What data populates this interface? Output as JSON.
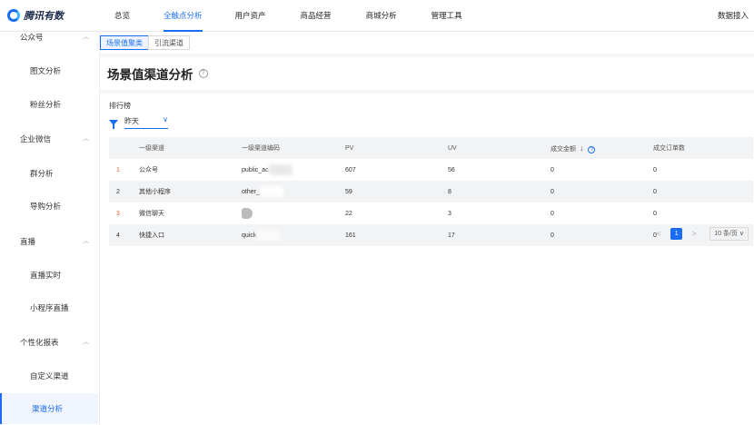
{
  "app": {
    "logo_text": "腾讯有数"
  },
  "nav": {
    "items": [
      {
        "label": "总览"
      },
      {
        "label": "全触点分析",
        "active": true
      },
      {
        "label": "用户资产"
      },
      {
        "label": "商品经营"
      },
      {
        "label": "商城分析"
      },
      {
        "label": "管理工具"
      }
    ],
    "right_label": "数据接入"
  },
  "sidebar": {
    "groups": [
      {
        "label": "公众号",
        "items": [
          "图文分析",
          "粉丝分析"
        ]
      },
      {
        "label": "企业微信",
        "items": [
          "群分析",
          "导购分析"
        ]
      },
      {
        "label": "直播",
        "items": [
          "直播实时",
          "小程序直播"
        ]
      },
      {
        "label": "个性化报表",
        "items": [
          "自定义渠道",
          "渠道分析"
        ]
      }
    ],
    "active_item": "渠道分析"
  },
  "tabs": [
    {
      "label": "场景值聚类",
      "active": true
    },
    {
      "label": "引流渠道"
    }
  ],
  "page_title": "场景值渠道分析",
  "ranking": {
    "title": "排行榜",
    "filter_value": "昨天",
    "columns": [
      "",
      "一级渠道",
      "一级渠道编码",
      "PV",
      "UV",
      "成交金额",
      "成交订单数"
    ],
    "rows": [
      {
        "rank": "1",
        "channel": "公众号",
        "code": "public_ac",
        "pv": "607",
        "uv": "56",
        "amount": "0",
        "orders": "0"
      },
      {
        "rank": "2",
        "channel": "其他小程序",
        "code": "other_",
        "pv": "59",
        "uv": "8",
        "amount": "0",
        "orders": "0"
      },
      {
        "rank": "3",
        "channel": "微信聊天",
        "code": "",
        "pv": "22",
        "uv": "3",
        "amount": "0",
        "orders": "0"
      },
      {
        "rank": "4",
        "channel": "快捷入口",
        "code": "quick",
        "pv": "161",
        "uv": "17",
        "amount": "0",
        "orders": "0"
      }
    ]
  },
  "pagination": {
    "current_page": "1",
    "page_size": "10 条/页"
  },
  "icons": {
    "help": "question-circle-icon",
    "filter": "filter-icon",
    "sort": "sort-down-icon"
  },
  "colors": {
    "accent": "#1a6df2",
    "rank_highlight": "#e8622e"
  }
}
